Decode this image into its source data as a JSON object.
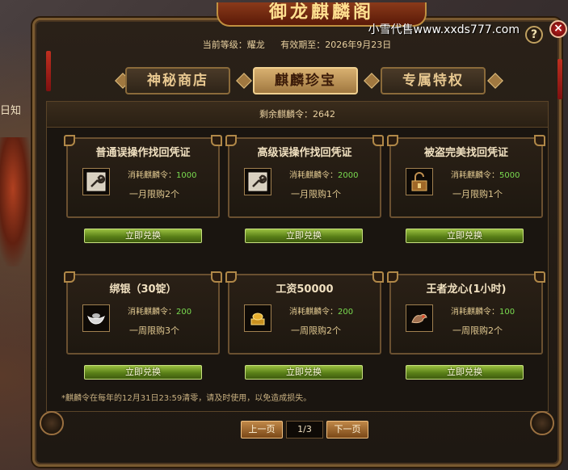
{
  "background": {
    "side_label": "日知"
  },
  "watermark": "小雪代售www.xxds777.com",
  "window": {
    "title": "御龙麒麟阁",
    "current_level_label": "当前等级：耀龙",
    "expiry_label": "有效期至：2026年9月23日",
    "help_label": "?",
    "close_label": "×"
  },
  "tabs": [
    {
      "label": "神秘商店",
      "active": false
    },
    {
      "label": "麒麟珍宝",
      "active": true
    },
    {
      "label": "专属特权",
      "active": false
    }
  ],
  "remaining": "剩余麒麟令：2642",
  "cost_prefix": "消耗麒麟令：",
  "redeem_label": "立即兑换",
  "items": [
    {
      "title": "普通误操作找回凭证",
      "icon": "wrench-icon",
      "cost": "1000",
      "limit": "一月限购2个"
    },
    {
      "title": "高级误操作找回凭证",
      "icon": "wrench-icon",
      "cost": "2000",
      "limit": "一月限购1个"
    },
    {
      "title": "被盗完美找回凭证",
      "icon": "unlocked-box-icon",
      "cost": "5000",
      "limit": "一月限购1个"
    },
    {
      "title": "绑银（30锭）",
      "icon": "silver-ingot-icon",
      "cost": "200",
      "limit": "一周限购3个"
    },
    {
      "title": "工资50000",
      "icon": "gold-ingot-icon",
      "cost": "200",
      "limit": "一周限购2个"
    },
    {
      "title": "王者龙心(1小时)",
      "icon": "dragon-icon",
      "cost": "100",
      "limit": "一周限购2个"
    }
  ],
  "note": "*麒麟令在每年的12月31日23:59清零，请及时使用，以免造成损失。",
  "pager": {
    "prev_label": "上一页",
    "page": "1/3",
    "next_label": "下一页"
  },
  "colors": {
    "accent_green": "#7adc50",
    "button_green": "#5a8018",
    "frame_gold": "#8a6a3a"
  }
}
